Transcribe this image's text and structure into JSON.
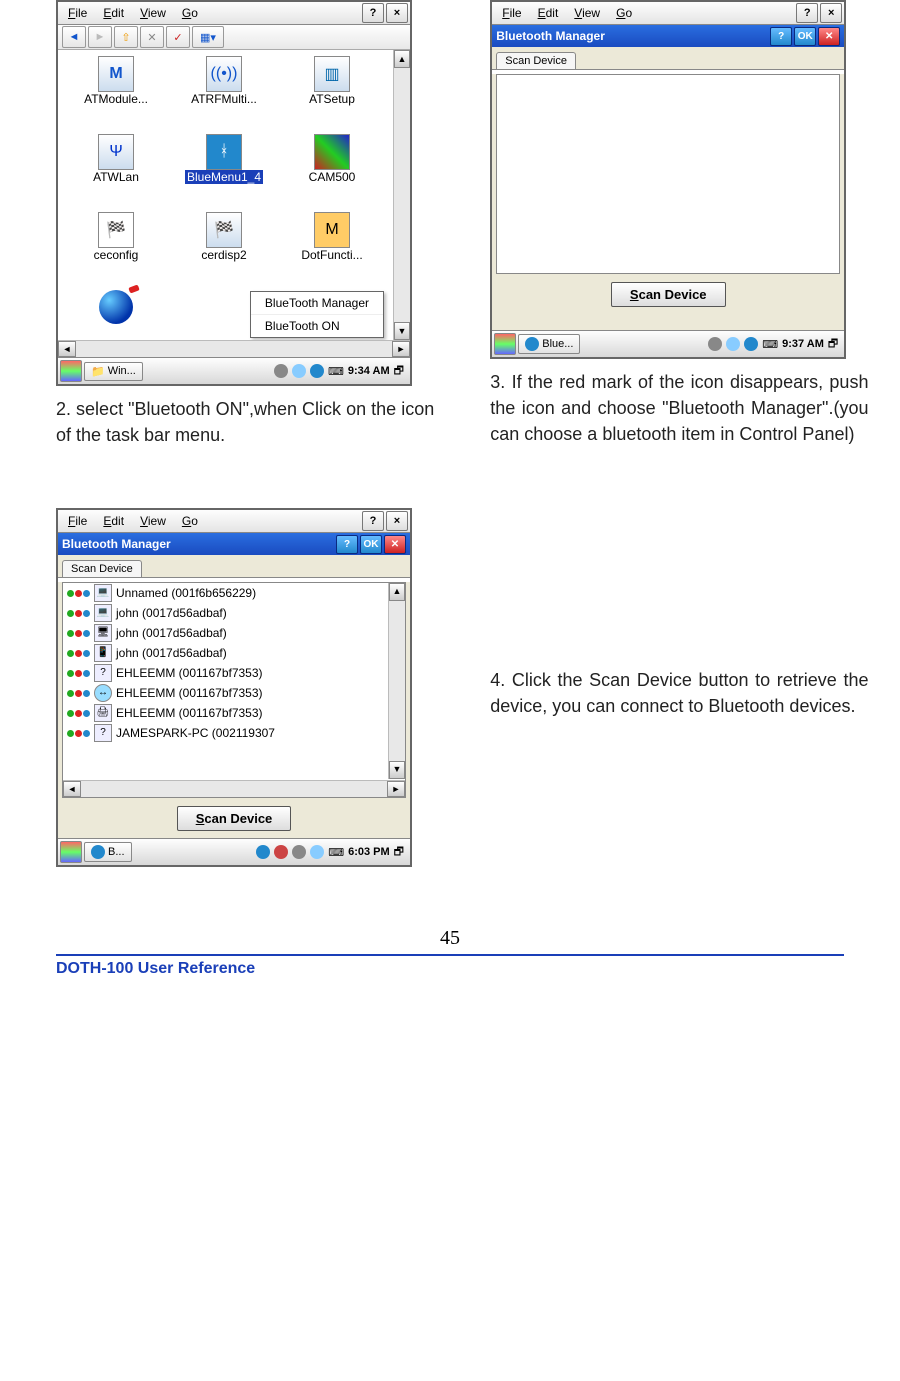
{
  "menus": {
    "file": "File",
    "edit": "Edit",
    "view": "View",
    "go": "Go"
  },
  "s1": {
    "icons": [
      "ATModule...",
      "ATRFMulti...",
      "ATSetup",
      "ATWLan",
      "BlueMenu1_4",
      "CAM500",
      "ceconfig",
      "cerdisp2",
      "DotFuncti..."
    ],
    "ctx": [
      "BlueTooth Manager",
      "BlueTooth ON"
    ],
    "task": "Win...",
    "time": "9:34 AM"
  },
  "s2": {
    "title": "Bluetooth Manager",
    "ok": "OK",
    "tab": "Scan Device",
    "scan": "Scan Device",
    "task": "Blue...",
    "time": "9:37 AM"
  },
  "s3": {
    "title": "Bluetooth Manager",
    "ok": "OK",
    "tab": "Scan Device",
    "scan": "Scan Device",
    "devices": [
      "Unnamed (001f6b656229)",
      "john (0017d56adbaf)",
      "john (0017d56adbaf)",
      "john (0017d56adbaf)",
      "EHLEEMM (001167bf7353)",
      "EHLEEMM (001167bf7353)",
      "EHLEEMM (001167bf7353)",
      "JAMESPARK-PC (002119307"
    ],
    "task": "B...",
    "time": "6:03 PM"
  },
  "captions": {
    "c2": "2. select \"Bluetooth ON\",when Click on the icon of the task bar menu.",
    "c3": "3. If the red mark of the icon disappears, push the icon and choose \"Bluetooth Manager\".(you can choose a bluetooth item in Control Panel)",
    "c4": "4. Click the Scan Device button to retrieve the device, you can connect to Bluetooth devices."
  },
  "page_number": "45",
  "footer": "DOTH-100 User Reference"
}
